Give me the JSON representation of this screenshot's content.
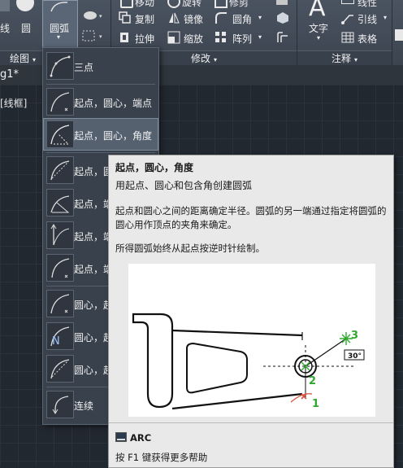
{
  "ribbon": {
    "draw_panel": {
      "line_label": "线",
      "circle_label": "圆",
      "arc_label": "圆弧",
      "title": "绘图"
    },
    "modify_panel": {
      "move_label": "移动",
      "rotate_label": "旋转",
      "trim_label": "修剪",
      "copy_label": "复制",
      "mirror_label": "镜像",
      "fillet_label": "圆角",
      "stretch_label": "拉伸",
      "scale_label": "缩放",
      "array_label": "阵列",
      "title": "修改"
    },
    "annotation_panel": {
      "text_label": "文字",
      "linear_label": "线性",
      "leader_label": "引线",
      "table_label": "表格",
      "title": "注释"
    }
  },
  "doc_tab": {
    "name": "g1*"
  },
  "viewport_label": "[线框]",
  "arc_menu": {
    "items": [
      {
        "label": "三点"
      },
      {
        "label": "起点，圆心，端点"
      },
      {
        "label": "起点，圆心，角度"
      },
      {
        "label": "起点，圆"
      },
      {
        "label": "起点，端"
      },
      {
        "label": "起点，端"
      },
      {
        "label": "起点，端"
      },
      {
        "label": "圆心，起"
      },
      {
        "label": "圆心，起"
      },
      {
        "label": "圆心，起"
      },
      {
        "label": "连续"
      }
    ]
  },
  "tooltip": {
    "title": "起点，圆心，角度",
    "subtitle": "用起点、圆心和包含角创建圆弧",
    "description": "起点和圆心之间的距离确定半径。圆弧的另一端通过指定将圆弧的圆心用作顶点的夹角来确定。",
    "note": "所得圆弧始终从起点按逆时针绘制。",
    "illustration": {
      "point_labels": [
        "1",
        "2",
        "3"
      ],
      "angle_label": "30°"
    },
    "command": "ARC",
    "help_text": "按 F1 键获得更多帮助"
  },
  "colors": {
    "accent_green": "#2fa82f",
    "marker_red": "#d9503f",
    "ribbon_bg": "#434b57"
  }
}
